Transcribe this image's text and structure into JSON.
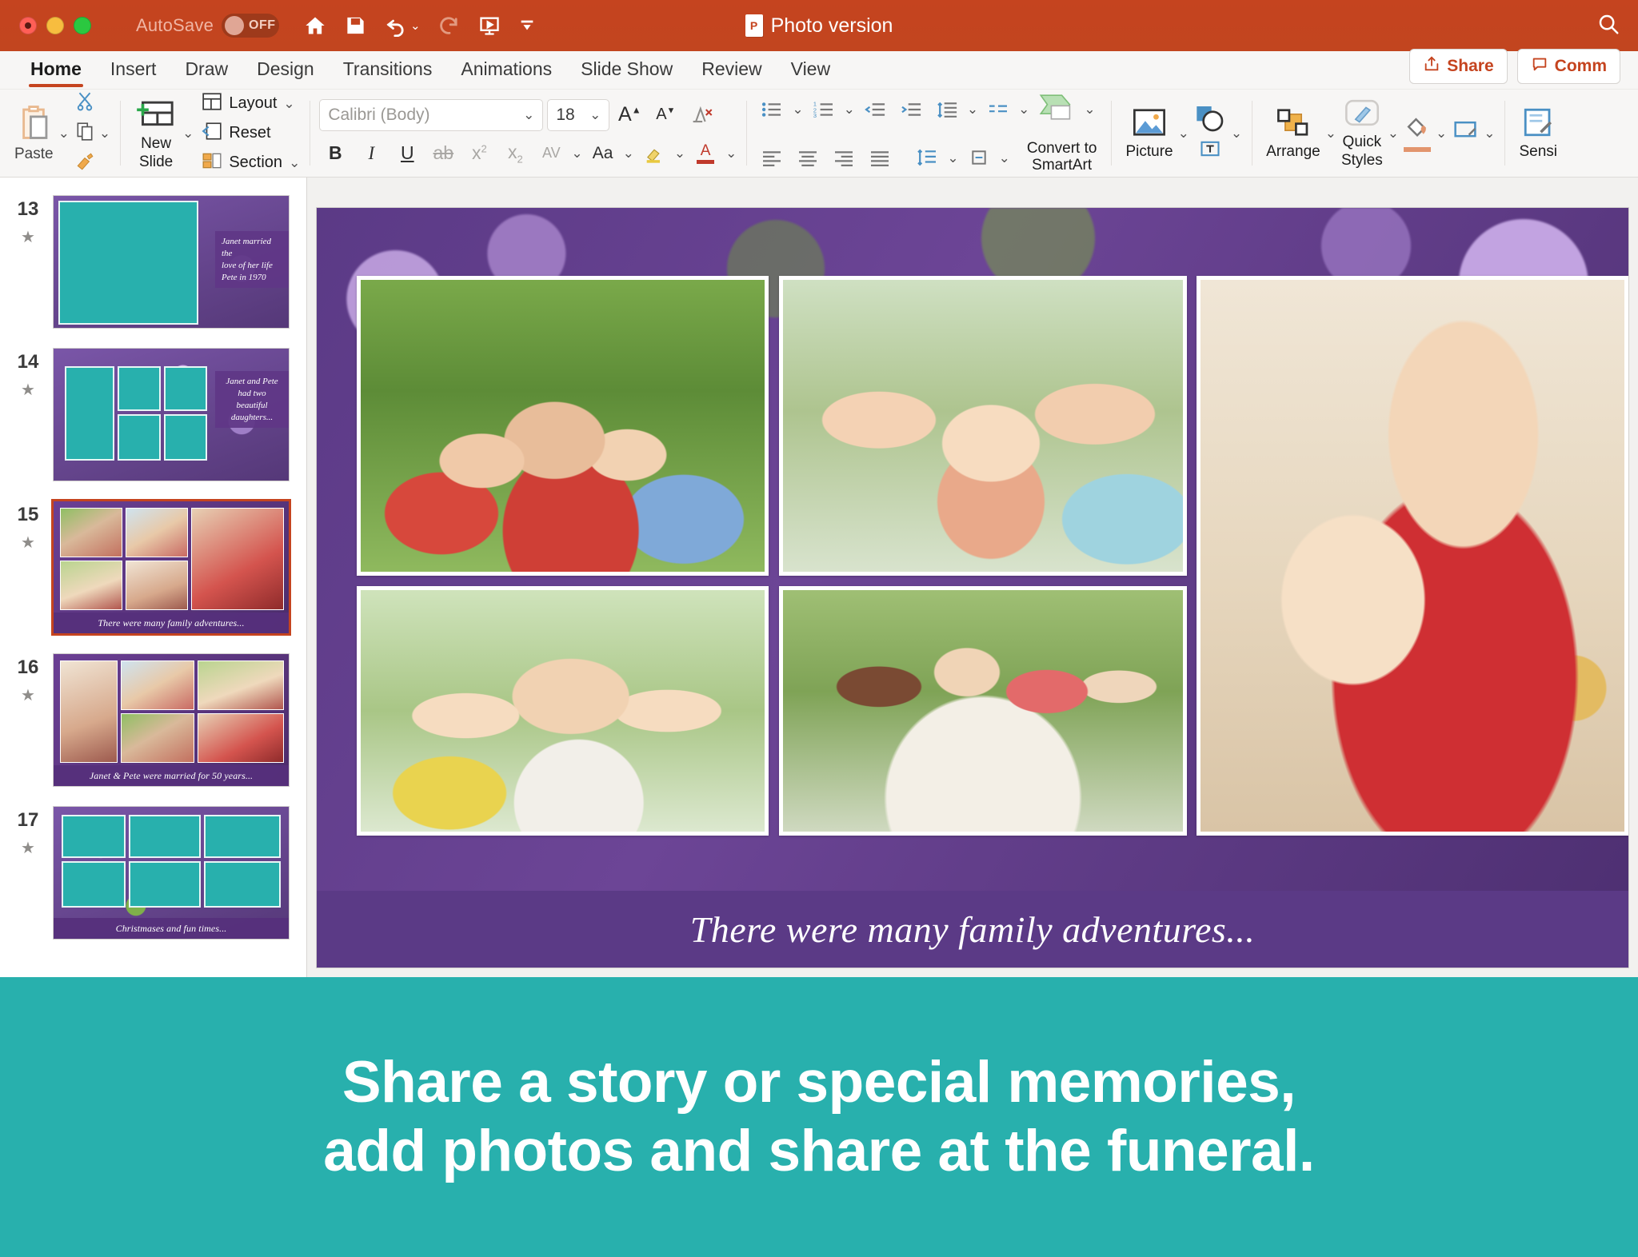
{
  "window": {
    "autosave_label": "AutoSave",
    "autosave_state": "OFF",
    "document_title": "Photo version",
    "app_icon": "powerpoint-icon",
    "traffic_lights": [
      "close",
      "minimize",
      "maximize"
    ],
    "quick_access": [
      {
        "name": "home-icon",
        "label": "Home"
      },
      {
        "name": "save-icon",
        "label": "Save"
      },
      {
        "name": "undo-icon",
        "label": "Undo"
      },
      {
        "name": "redo-icon",
        "label": "Redo"
      },
      {
        "name": "start-slideshow-icon",
        "label": "Start Slide Show"
      },
      {
        "name": "customize-toolbar-icon",
        "label": "Customize Quick Access Toolbar"
      }
    ],
    "search_icon": "search-icon"
  },
  "ribbon": {
    "tabs": [
      {
        "label": "Home",
        "active": true
      },
      {
        "label": "Insert",
        "active": false
      },
      {
        "label": "Draw",
        "active": false
      },
      {
        "label": "Design",
        "active": false
      },
      {
        "label": "Transitions",
        "active": false
      },
      {
        "label": "Animations",
        "active": false
      },
      {
        "label": "Slide Show",
        "active": false
      },
      {
        "label": "Review",
        "active": false
      },
      {
        "label": "View",
        "active": false
      }
    ],
    "share_label": "Share",
    "comments_label": "Comm",
    "clipboard": {
      "paste_label": "Paste",
      "cut_label": "Cut",
      "copy_label": "Copy",
      "format_painter_label": "Format Painter"
    },
    "slides": {
      "new_slide_label": "New\nSlide",
      "new_slide_line1": "New",
      "new_slide_line2": "Slide",
      "layout_label": "Layout",
      "reset_label": "Reset",
      "section_label": "Section"
    },
    "font": {
      "family_value": "Calibri (Body)",
      "size_value": "18",
      "grow_font": "A",
      "shrink_font": "A",
      "clear_formatting": "A",
      "bold": "B",
      "italic": "I",
      "underline": "U",
      "strikethrough": "S",
      "superscript": "x",
      "subscript": "x",
      "character_spacing": "AV",
      "change_case": "Aa",
      "highlight": "highlight-icon",
      "font_color": "A"
    },
    "paragraph": {
      "bullets": "bullets-icon",
      "numbering": "numbering-icon",
      "decrease_indent": "decrease-indent-icon",
      "increase_indent": "increase-indent-icon",
      "line_spacing": "line-spacing-icon",
      "align_left": "align-left-icon",
      "align_center": "align-center-icon",
      "align_right": "align-right-icon",
      "justify": "justify-icon",
      "text_direction": "text-direction-icon",
      "align_text": "align-text-icon",
      "columns": "columns-icon",
      "convert_smartart_line1": "Convert to",
      "convert_smartart_line2": "SmartArt"
    },
    "insert_group": {
      "picture_label": "Picture",
      "shapes_label": "Shapes",
      "text_box_label": "Text Box"
    },
    "drawing_group": {
      "arrange_label": "Arrange",
      "quick_styles_line1": "Quick",
      "quick_styles_line2": "Styles",
      "shape_fill_label": "Shape Fill",
      "shape_outline_label": "Shape Outline"
    },
    "sensitivity_label": "Sensi"
  },
  "thumbnails": [
    {
      "number": "13",
      "caption": "Janet married the\nlove of her life\nPete in 1970",
      "caption_position": "right",
      "selected": false,
      "layout": "single-left"
    },
    {
      "number": "14",
      "caption": "Janet and Pete\nhad two\nbeautiful\ndaughters...",
      "caption_position": "right",
      "selected": false,
      "layout": "grid-five"
    },
    {
      "number": "15",
      "caption": "There were many family adventures...",
      "caption_position": "bottom",
      "selected": true,
      "layout": "photo-collage"
    },
    {
      "number": "16",
      "caption": "Janet & Pete were married for 50 years...",
      "caption_position": "bottom",
      "selected": false,
      "layout": "photo-collage"
    },
    {
      "number": "17",
      "caption": "Christmases and fun times...",
      "caption_position": "bottom",
      "selected": false,
      "layout": "grid-placeholder"
    }
  ],
  "slide": {
    "caption": "There were many family adventures...",
    "photos": [
      {
        "name": "photo-family-group",
        "alt": "Large family group taking selfie in garden"
      },
      {
        "name": "photo-grandmother-selfie",
        "alt": "Grandmother, toddler and mother selfie"
      },
      {
        "name": "photo-grandmother-girl-portrait",
        "alt": "Grandmother and granddaughter with ornament"
      },
      {
        "name": "photo-three-generations",
        "alt": "Girl, grandmother and mother smiling outdoors"
      },
      {
        "name": "photo-family-dinner",
        "alt": "Family around outdoor dinner table"
      }
    ]
  },
  "banner": {
    "line1": "Share a story or special memories,",
    "line2": "add photos and share at the funeral."
  },
  "colors": {
    "titlebar": "#c5441f",
    "accent": "#c5441f",
    "banner": "#28b0ad",
    "slide_purple": "#5b3a86",
    "teal_placeholder": "#28b0ad"
  }
}
